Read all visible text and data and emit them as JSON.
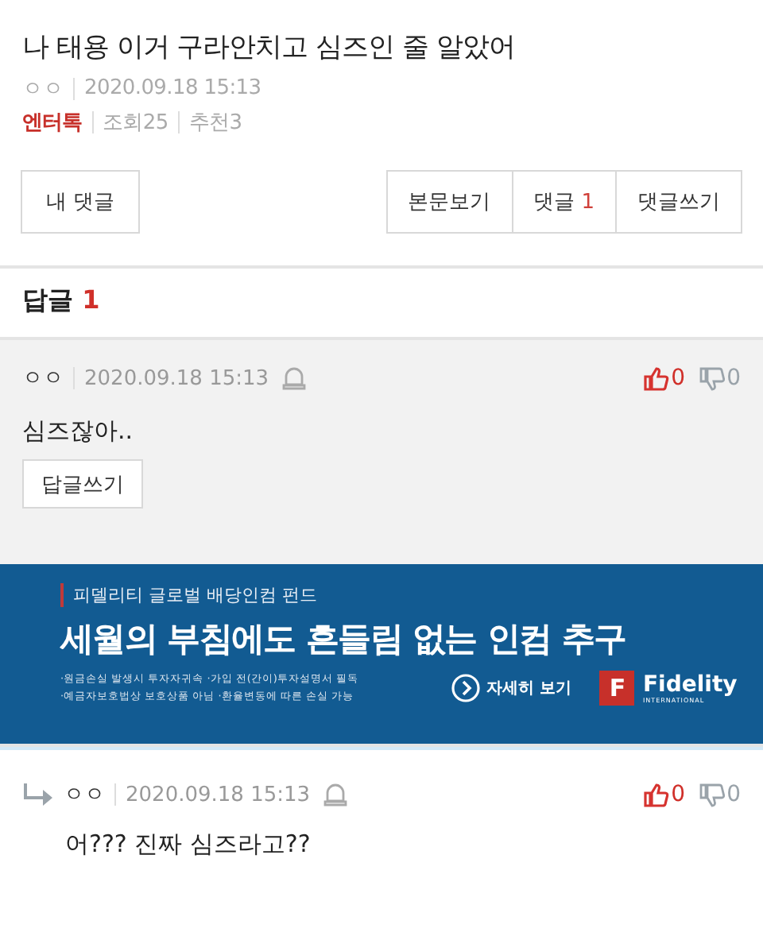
{
  "post": {
    "title": "나 태용 이거 구라안치고 심즈인 줄 알았어",
    "author": "ㅇㅇ",
    "date": "2020.09.18 15:13",
    "category": "엔터톡",
    "views": "조회25",
    "recommends": "추천3"
  },
  "toolbar": {
    "left_button": "내 댓글",
    "buttons": [
      {
        "label": "본문보기"
      },
      {
        "label": "댓글",
        "count": "1"
      },
      {
        "label": "댓글쓰기"
      }
    ]
  },
  "replies_header": {
    "label": "답글",
    "count": "1"
  },
  "comments": [
    {
      "kind": "comment",
      "author": "ㅇㅇ",
      "date": "2020.09.18 15:13",
      "likes": "0",
      "dislikes": "0",
      "text": "심즈잖아..",
      "reply_button": "답글쓰기"
    },
    {
      "kind": "ad",
      "subtitle": "피델리티 글로벌 배당인컴 펀드",
      "headline": "세월의 부침에도 흔들림 없는 인컴 추구",
      "notes": [
        "·원금손실 발생시 투자자귀속 ·가입 전(간이)투자설명서 필독",
        "·예금자보호법상 보호상품 아님 ·환율변동에 따른 손실 가능"
      ],
      "more": "자세히 보기",
      "logo_letter": "F",
      "brand": "Fidelity",
      "brand_sub": "INTERNATIONAL"
    },
    {
      "kind": "reply",
      "author": "ㅇㅇ",
      "date": "2020.09.18 15:13",
      "likes": "0",
      "dislikes": "0",
      "text": "어??? 진짜 심즈라고??"
    }
  ]
}
